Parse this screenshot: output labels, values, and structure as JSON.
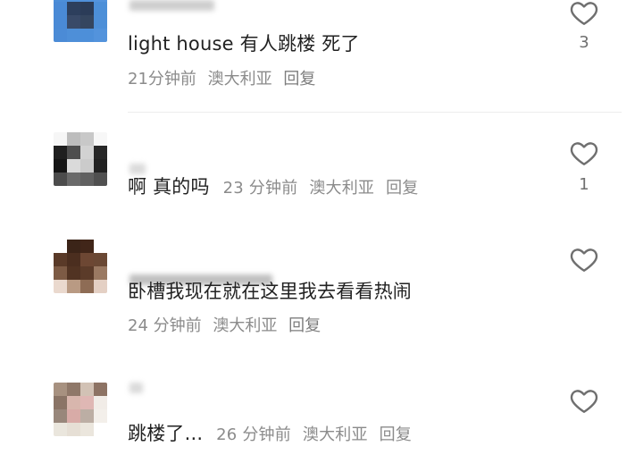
{
  "comments": [
    {
      "text": "light house 有人跳楼 死了",
      "time": "21分钟前",
      "location": "澳大利亚",
      "reply_label": "回复",
      "likes": "3"
    },
    {
      "text": "啊 真的吗",
      "time": "23 分钟前",
      "location": "澳大利亚",
      "reply_label": "回复",
      "likes": "1"
    },
    {
      "text": "卧槽我现在就在这里我去看看热闹",
      "time": "24 分钟前",
      "location": "澳大利亚",
      "reply_label": "回复",
      "likes": ""
    },
    {
      "text": "跳楼了...",
      "time": "26 分钟前",
      "location": "澳大利亚",
      "reply_label": "回复",
      "likes": ""
    }
  ],
  "icons": {
    "like": "heart-outline-icon"
  },
  "colors": {
    "meta_text": "#8b8b8b",
    "heart_stroke": "#6f6f6f"
  }
}
